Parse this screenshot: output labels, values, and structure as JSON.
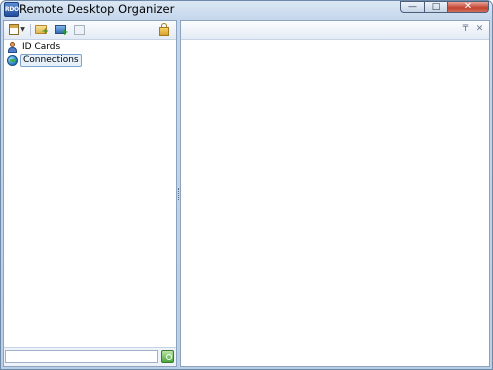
{
  "window": {
    "title": "Remote Desktop Organizer",
    "app_icon_text": "RDO",
    "caption_buttons": {
      "minimize": "—",
      "maximize": "□",
      "close": "✕"
    }
  },
  "left_toolbar": {
    "icons": [
      "new-document-icon",
      "dropdown-arrow-icon",
      "new-folder-icon",
      "new-connection-icon",
      "copy-icon",
      "lock-icon"
    ],
    "dropdown_glyph": "▼"
  },
  "tree": {
    "items": [
      {
        "label": "ID Cards",
        "icon": "id-card-icon",
        "selected": false
      },
      {
        "label": "Connections",
        "icon": "globe-icon",
        "selected": true
      }
    ]
  },
  "filter": {
    "value": "",
    "placeholder": ""
  },
  "right_pane": {
    "header_buttons": {
      "pin": "₸",
      "close": "✕"
    }
  },
  "colors": {
    "frame": "#b9cfe7",
    "border": "#8da2bd",
    "selection": "#e6f0fb",
    "close_button": "#c0432f"
  }
}
